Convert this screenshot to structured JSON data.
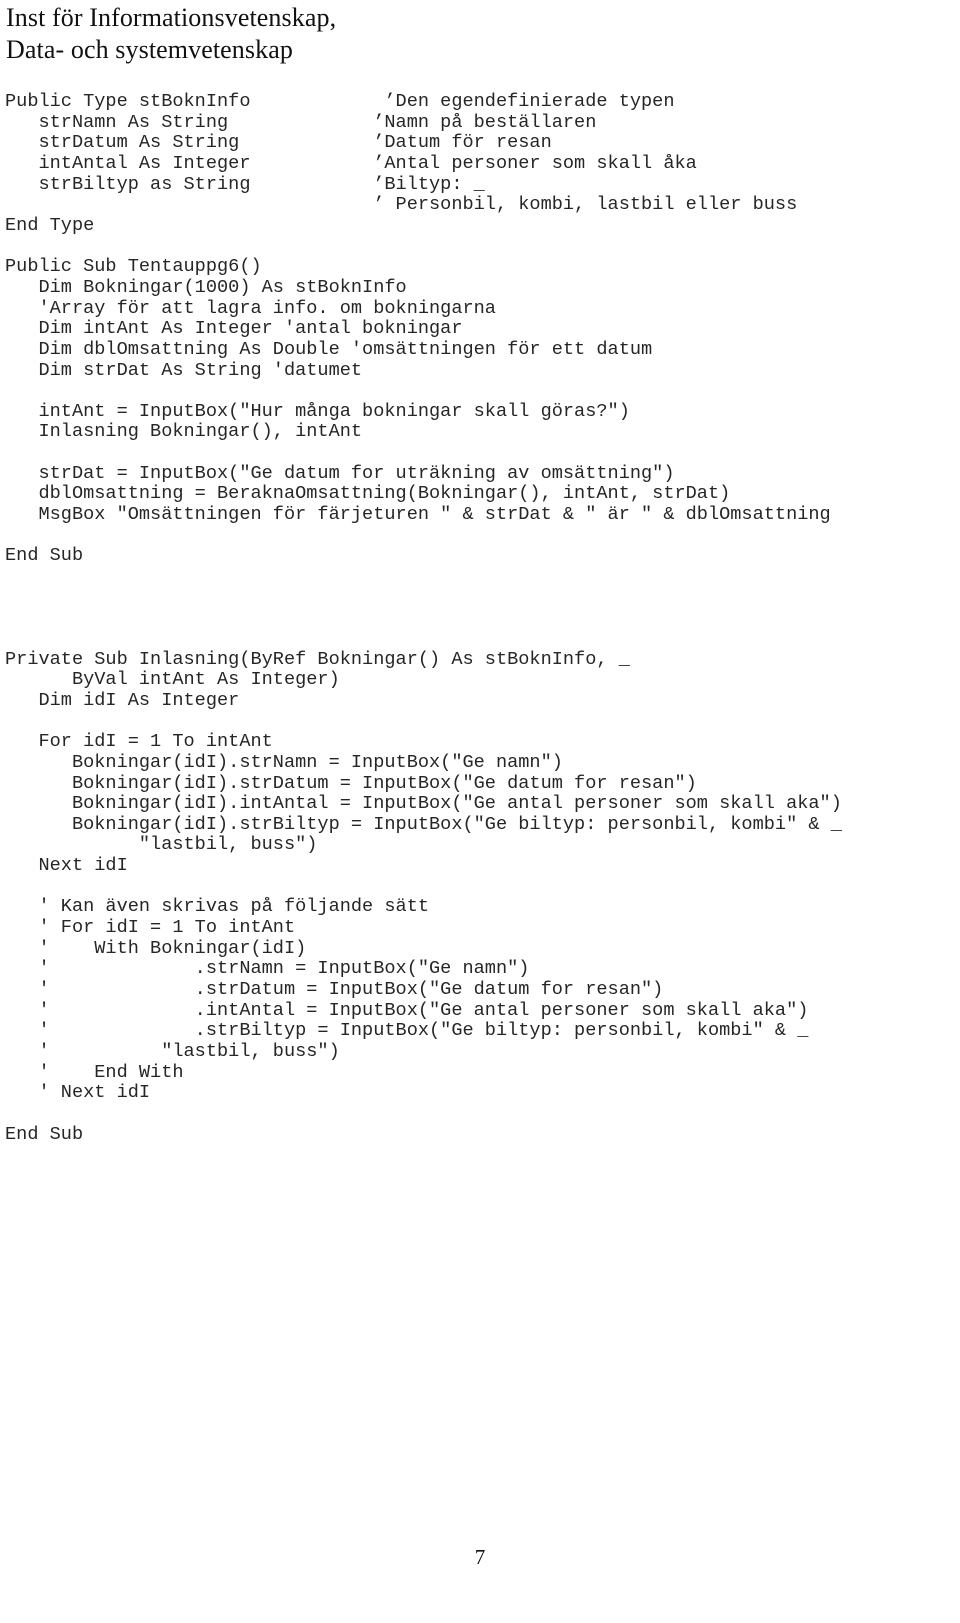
{
  "header": {
    "lines": [
      "Inst för Informationsvetenskap,",
      "Data- och systemvetenskap"
    ]
  },
  "code": {
    "language": "Visual Basic for Applications",
    "lines": [
      "Public Type stBoknInfo            ’Den egendefinierade typen",
      "   strNamn As String             ’Namn på beställaren",
      "   strDatum As String            ’Datum för resan",
      "   intAntal As Integer           ’Antal personer som skall åka",
      "   strBiltyp as String           ’Biltyp: _",
      "                                 ’ Personbil, kombi, lastbil eller buss",
      "End Type",
      "",
      "Public Sub Tentauppg6()",
      "   Dim Bokningar(1000) As stBoknInfo",
      "   'Array för att lagra info. om bokningarna",
      "   Dim intAnt As Integer 'antal bokningar",
      "   Dim dblOmsattning As Double 'omsättningen för ett datum",
      "   Dim strDat As String 'datumet",
      "",
      "   intAnt = InputBox(\"Hur många bokningar skall göras?\")",
      "   Inlasning Bokningar(), intAnt",
      "",
      "   strDat = InputBox(\"Ge datum for uträkning av omsättning\")",
      "   dblOmsattning = BeraknaOmsattning(Bokningar(), intAnt, strDat)",
      "   MsgBox \"Omsättningen för färjeturen \" & strDat & \" är \" & dblOmsattning",
      "",
      "End Sub",
      "",
      "",
      "",
      "",
      "Private Sub Inlasning(ByRef Bokningar() As stBoknInfo, _",
      "      ByVal intAnt As Integer)",
      "   Dim idI As Integer",
      "",
      "   For idI = 1 To intAnt",
      "      Bokningar(idI).strNamn = InputBox(\"Ge namn\")",
      "      Bokningar(idI).strDatum = InputBox(\"Ge datum for resan\")",
      "      Bokningar(idI).intAntal = InputBox(\"Ge antal personer som skall aka\")",
      "      Bokningar(idI).strBiltyp = InputBox(\"Ge biltyp: personbil, kombi\" & _",
      "            \"lastbil, buss\")",
      "   Next idI",
      "",
      "   ' Kan även skrivas på följande sätt",
      "   ' For idI = 1 To intAnt",
      "   '    With Bokningar(idI)",
      "   '             .strNamn = InputBox(\"Ge namn\")",
      "   '             .strDatum = InputBox(\"Ge datum for resan\")",
      "   '             .intAntal = InputBox(\"Ge antal personer som skall aka\")",
      "   '             .strBiltyp = InputBox(\"Ge biltyp: personbil, kombi\" & _",
      "   '          \"lastbil, buss\")",
      "   '    End With",
      "   ' Next idI",
      "",
      "End Sub"
    ]
  },
  "footer": {
    "page_number": "7"
  }
}
